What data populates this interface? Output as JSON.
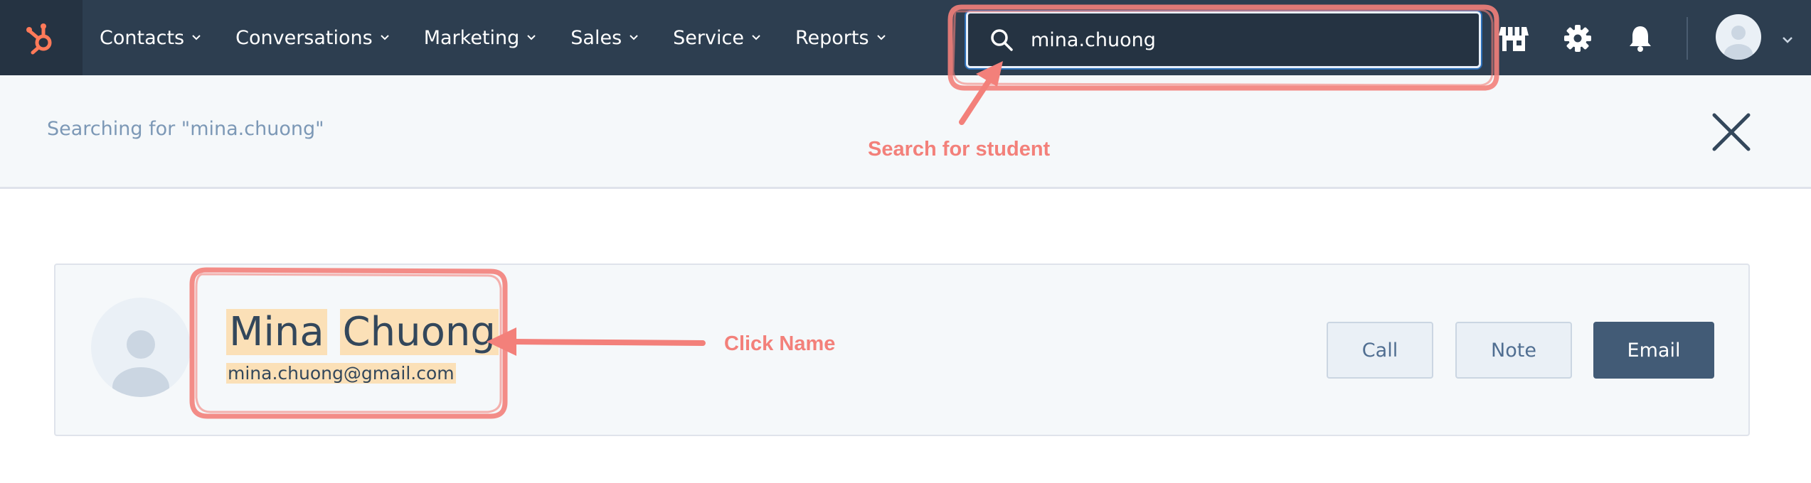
{
  "nav": {
    "items": [
      {
        "label": "Contacts"
      },
      {
        "label": "Conversations"
      },
      {
        "label": "Marketing"
      },
      {
        "label": "Sales"
      },
      {
        "label": "Service"
      },
      {
        "label": "Reports"
      }
    ],
    "search_value": "mina.chuong"
  },
  "banner": {
    "text": "Searching for \"mina.chuong\""
  },
  "result": {
    "first_name": "Mina",
    "last_name": "Chuong",
    "email": "mina.chuong@gmail.com",
    "actions": {
      "call": "Call",
      "note": "Note",
      "email": "Email"
    }
  },
  "annotations": {
    "search_label": "Search for student",
    "click_label": "Click Name"
  },
  "colors": {
    "nav_bg": "#2d3e50",
    "logo_orange": "#ff7a59",
    "annotation": "#f3807a",
    "highlight": "#fbe0b7",
    "primary_button": "#425b76"
  },
  "icons": [
    "hubspot-logo-icon",
    "chevron-down-icon",
    "search-icon",
    "marketplace-icon",
    "gear-icon",
    "bell-icon",
    "avatar",
    "close-icon"
  ]
}
